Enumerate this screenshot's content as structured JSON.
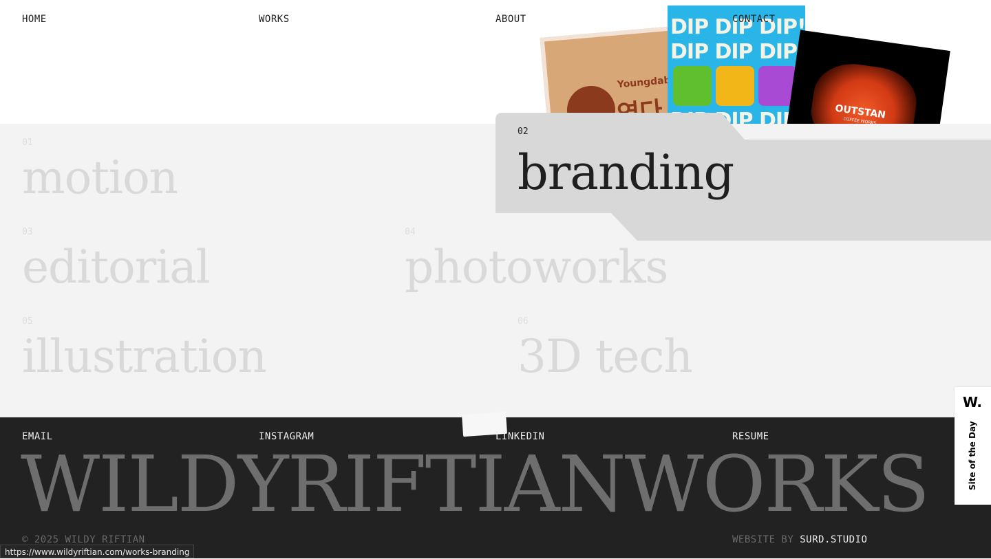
{
  "nav": {
    "home": "HOME",
    "works": "WORKS",
    "about": "ABOUT",
    "contact": "CONTACT"
  },
  "preview_images": {
    "youngdabang": {
      "label": "Youngdabang",
      "label_ko": "영다방"
    },
    "dip": {
      "rows": [
        "DIP DIP DIP!",
        "DIP DIP DIP!",
        "DIP DIP DIP!"
      ]
    },
    "outstan": {
      "label": "OUTSTAN",
      "sub": "COFFEE WORKS"
    }
  },
  "categories": [
    {
      "num": "01",
      "title": "motion"
    },
    {
      "num": "02",
      "title": "branding",
      "active": true
    },
    {
      "num": "03",
      "title": "editorial"
    },
    {
      "num": "04",
      "title": "photoworks"
    },
    {
      "num": "05",
      "title": "illustration"
    },
    {
      "num": "06",
      "title": "3D tech"
    }
  ],
  "footer": {
    "links": {
      "email": "EMAIL",
      "instagram": "INSTAGRAM",
      "linkedin": "LINKEDIN",
      "resume": "RESUME"
    },
    "wordmark": "WILDYRIFTIANWORKS",
    "copyright": "© 2025 WILDY RIFTIAN",
    "credit_prefix": "WEBSITE BY",
    "credit_studio": "SURD.STUDIO"
  },
  "award": {
    "logo": "W.",
    "label": "Site of the Day"
  },
  "status_url": "https://www.wildyriftian.com/works-branding",
  "colors": {
    "panel": "#f3f3f3",
    "active_tab": "#d8d8d8",
    "footer": "#222222",
    "inactive_text": "#d9d9d9"
  }
}
